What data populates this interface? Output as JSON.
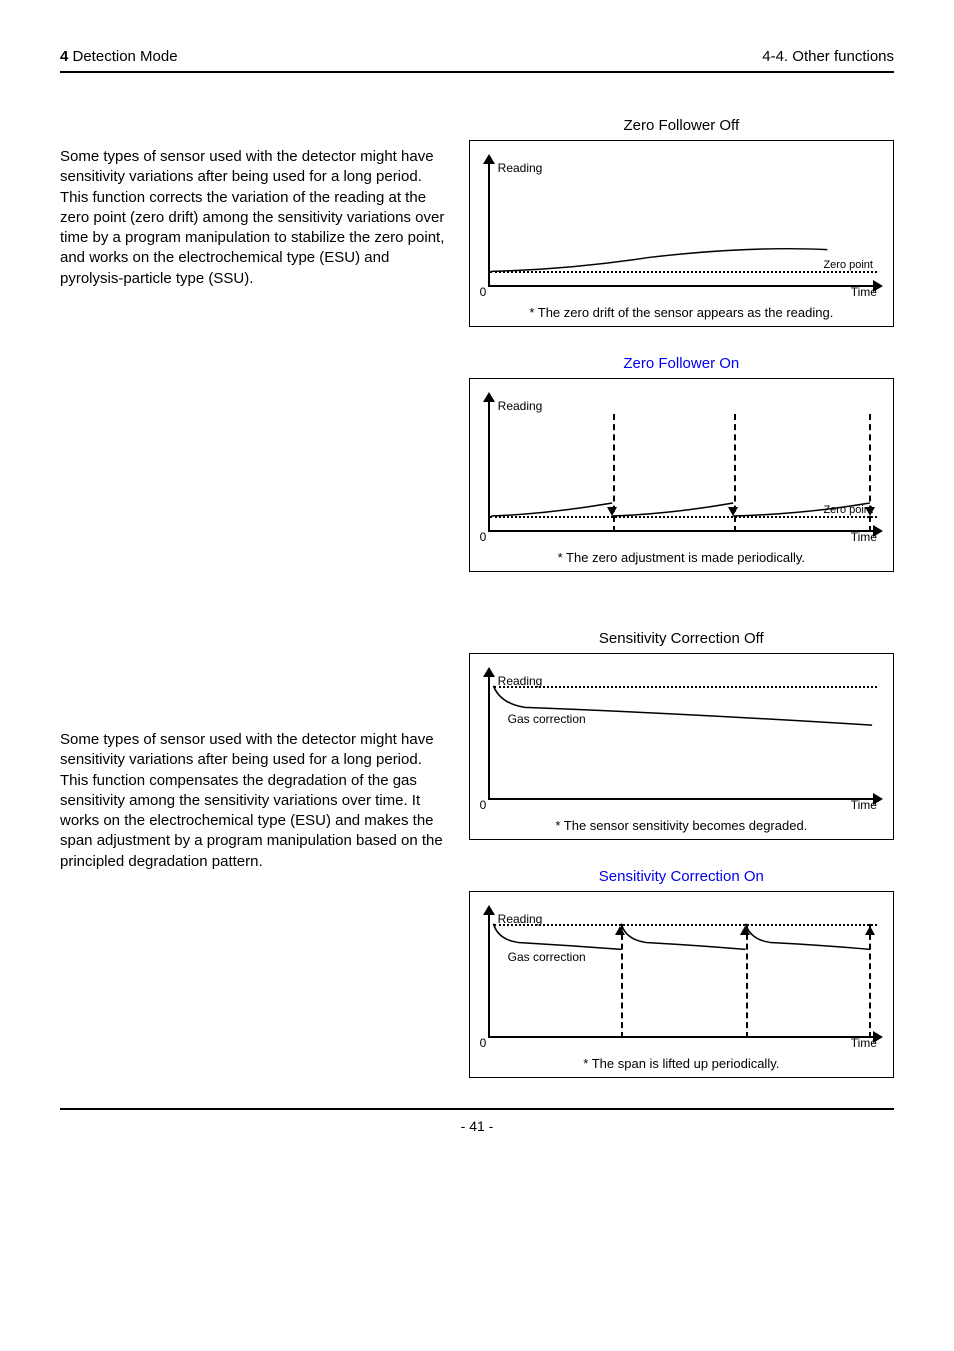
{
  "header": {
    "chapter_num": "4",
    "chapter_title": " Detection Mode",
    "right": "4-4. Other functions"
  },
  "para1": "Some types of sensor used with the detector might have sensitivity variations after being used for a long period.\nThis function corrects the variation of the reading at the zero point (zero drift) among the sensitivity variations over time by a program manipulation to stabilize the zero point, and works on the electrochemical type (ESU) and pyrolysis-particle type (SSU).",
  "para2": "Some types of sensor used with the detector might have sensitivity variations after being used for a long period.\nThis function compensates the degradation of the gas sensitivity among the sensitivity variations over time. It works on the electrochemical type (ESU) and makes the span adjustment by a program manipulation based on the principled degradation pattern.",
  "charts": {
    "zfo": {
      "title": "Zero Follower Off",
      "caption": "* The zero drift of the sensor appears as the reading."
    },
    "zfon": {
      "title": "Zero Follower On",
      "caption": "* The zero adjustment is made periodically."
    },
    "sco": {
      "title": "Sensitivity Correction Off",
      "caption": "* The sensor sensitivity becomes degraded."
    },
    "scon": {
      "title": "Sensitivity Correction On",
      "caption": "* The span is lifted up periodically."
    }
  },
  "labels": {
    "reading": "Reading",
    "time": "Time",
    "zero_point": "Zero point",
    "zero": "0",
    "gas_correction": "Gas correction"
  },
  "page_number": "- 41 -",
  "chart_data": [
    {
      "id": "zero_follower_off",
      "type": "line",
      "title": "Zero Follower Off",
      "xlabel": "Time",
      "ylabel": "Reading",
      "series": [
        {
          "name": "reading",
          "style": "solid",
          "points": [
            [
              0,
              0.02
            ],
            [
              0.25,
              0.06
            ],
            [
              0.5,
              0.12
            ],
            [
              0.7,
              0.18
            ],
            [
              1.0,
              0.16
            ]
          ]
        },
        {
          "name": "zero_point",
          "style": "dotted",
          "points": [
            [
              0,
              0
            ],
            [
              1,
              0
            ]
          ]
        }
      ],
      "annotations": [
        "Zero point"
      ],
      "ylim": [
        0,
        1
      ]
    },
    {
      "id": "zero_follower_on",
      "type": "line",
      "title": "Zero Follower On",
      "xlabel": "Time",
      "ylabel": "Reading",
      "series": [
        {
          "name": "reading_seg1",
          "style": "solid",
          "points": [
            [
              0,
              0.02
            ],
            [
              0.33,
              0.1
            ]
          ]
        },
        {
          "name": "reading_seg2",
          "style": "solid",
          "points": [
            [
              0.33,
              0.02
            ],
            [
              0.66,
              0.1
            ]
          ]
        },
        {
          "name": "reading_seg3",
          "style": "solid",
          "points": [
            [
              0.66,
              0.02
            ],
            [
              1.0,
              0.1
            ]
          ]
        },
        {
          "name": "zero_point",
          "style": "dotted",
          "points": [
            [
              0,
              0
            ],
            [
              1,
              0
            ]
          ]
        }
      ],
      "periodic_reset_x": [
        0.33,
        0.66,
        1.0
      ],
      "annotations": [
        "Zero point",
        "periodic down-arrows at reset points"
      ],
      "ylim": [
        0,
        1
      ]
    },
    {
      "id": "sensitivity_correction_off",
      "type": "line",
      "title": "Sensitivity Correction Off",
      "xlabel": "Time",
      "ylabel": "Reading",
      "series": [
        {
          "name": "gas_correction_target",
          "style": "dotted",
          "points": [
            [
              0,
              1
            ],
            [
              1,
              1
            ]
          ]
        },
        {
          "name": "reading",
          "style": "solid",
          "points": [
            [
              0,
              1.0
            ],
            [
              0.05,
              0.82
            ],
            [
              0.3,
              0.78
            ],
            [
              0.5,
              0.76
            ],
            [
              1.0,
              0.7
            ]
          ]
        }
      ],
      "annotations": [
        "Gas correction"
      ],
      "ylim": [
        0,
        1.1
      ]
    },
    {
      "id": "sensitivity_correction_on",
      "type": "line",
      "title": "Sensitivity Correction On",
      "xlabel": "Time",
      "ylabel": "Reading",
      "series": [
        {
          "name": "gas_correction_target",
          "style": "dotted",
          "points": [
            [
              0,
              1
            ],
            [
              1,
              1
            ]
          ]
        },
        {
          "name": "reading_seg1",
          "style": "solid",
          "points": [
            [
              0,
              1.0
            ],
            [
              0.05,
              0.85
            ],
            [
              0.33,
              0.8
            ]
          ]
        },
        {
          "name": "reading_seg2",
          "style": "solid",
          "points": [
            [
              0.33,
              1.0
            ],
            [
              0.38,
              0.85
            ],
            [
              0.66,
              0.8
            ]
          ]
        },
        {
          "name": "reading_seg3",
          "style": "solid",
          "points": [
            [
              0.66,
              1.0
            ],
            [
              0.71,
              0.85
            ],
            [
              1.0,
              0.8
            ]
          ]
        }
      ],
      "periodic_lift_x": [
        0.33,
        0.66,
        1.0
      ],
      "annotations": [
        "Gas correction",
        "periodic up-arrows at lift points"
      ],
      "ylim": [
        0,
        1.1
      ]
    }
  ]
}
